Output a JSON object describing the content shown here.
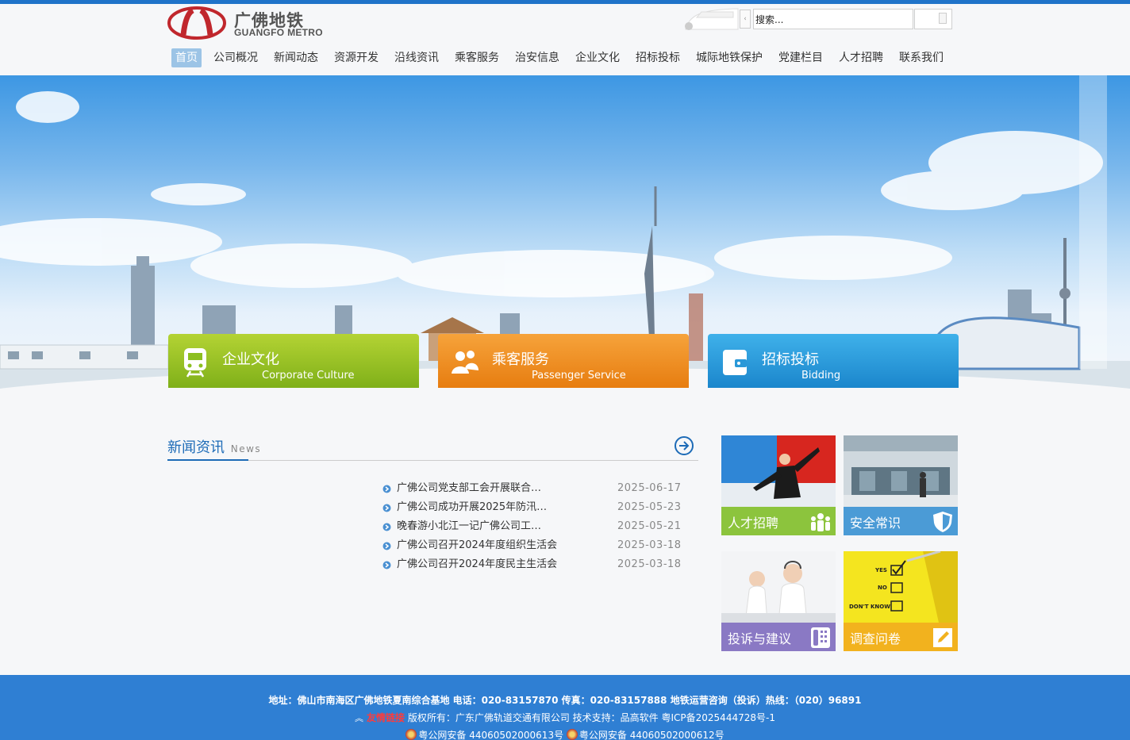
{
  "brand": {
    "name_cn": "广佛地铁",
    "name_en": "GUANGFO METRO",
    "logo_color": "#c0272d",
    "accent_color": "#1f73c9"
  },
  "search": {
    "placeholder": "",
    "value": "搜索..."
  },
  "nav": {
    "items": [
      "首页",
      "公司概况",
      "新闻动态",
      "资源开发",
      "沿线资讯",
      "乘客服务",
      "治安信息",
      "企业文化",
      "招标投标",
      "城际地铁保护",
      "党建栏目",
      "人才招聘",
      "联系我们"
    ],
    "active": "首页"
  },
  "cards": [
    {
      "title": "企业文化",
      "subtitle": "Corporate Culture",
      "icon": "train-icon",
      "color": "#8cbf1f"
    },
    {
      "title": "乘客服务",
      "subtitle": "Passenger Service",
      "icon": "people-icon",
      "color": "#ec8a18"
    },
    {
      "title": "招标投标",
      "subtitle": "Bidding",
      "icon": "wallet-icon",
      "color": "#2a98d8"
    }
  ],
  "news": {
    "title": "新闻资讯",
    "title_en": "News",
    "more_icon": "arrow-right-circle-icon",
    "items": [
      {
        "title": "广佛公司党支部工会开展联合…",
        "date": "2025-06-17"
      },
      {
        "title": "广佛公司成功开展2025年防汛…",
        "date": "2025-05-23"
      },
      {
        "title": "晚春游小北江一记广佛公司工…",
        "date": "2025-05-21"
      },
      {
        "title": "广佛公司召开2024年度组织生活会",
        "date": "2025-03-18"
      },
      {
        "title": "广佛公司召开2024年度民主生活会",
        "date": "2025-03-18"
      }
    ]
  },
  "tiles": [
    {
      "label": "人才招聘",
      "icon": "team-icon",
      "bar_color": "#8cc43d"
    },
    {
      "label": "安全常识",
      "icon": "shield-icon",
      "bar_color": "#4b9bd6"
    },
    {
      "label": "投诉与建议",
      "icon": "phone-icon",
      "bar_color": "#8a79c4"
    },
    {
      "label": "调查问卷",
      "icon": "pencil-icon",
      "bar_color": "#f2b21e"
    }
  ],
  "survey_pic": {
    "yes": "YES",
    "no": "NO",
    "dont_know": "DON'T KNOW"
  },
  "footer": {
    "line1": "地址：佛山市南海区广佛地铁夏南综合基地 电话：020-83157870 传真：020-83157888 地铁运营咨询（投诉）热线：（020）96891",
    "friend_links": "友情链接",
    "line2_rest": "版权所有：广东广佛轨道交通有限公司 技术支持：品高软件 粤ICP备2025444728号-1",
    "police1": "粤公网安备 44060502000613号",
    "police2": "粤公网安备 44060502000612号"
  }
}
